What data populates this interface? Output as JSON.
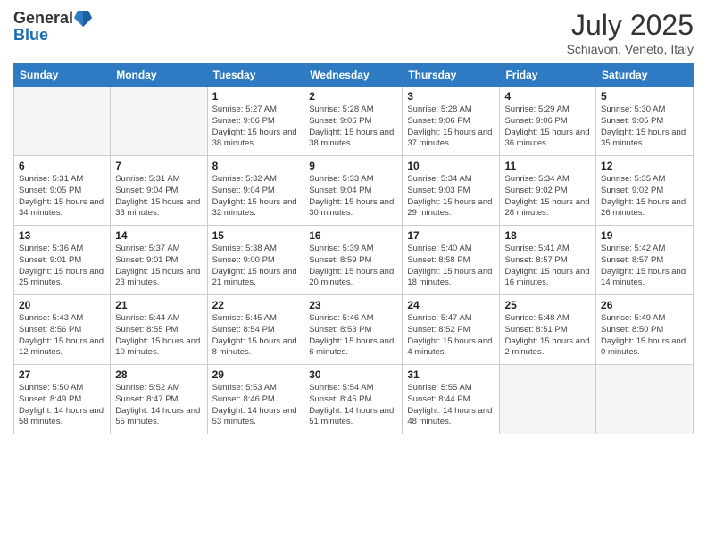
{
  "header": {
    "logo_general": "General",
    "logo_blue": "Blue",
    "month_year": "July 2025",
    "location": "Schiavon, Veneto, Italy"
  },
  "days_of_week": [
    "Sunday",
    "Monday",
    "Tuesday",
    "Wednesday",
    "Thursday",
    "Friday",
    "Saturday"
  ],
  "weeks": [
    [
      {
        "day": "",
        "info": ""
      },
      {
        "day": "",
        "info": ""
      },
      {
        "day": "1",
        "info": "Sunrise: 5:27 AM\nSunset: 9:06 PM\nDaylight: 15 hours and 38 minutes."
      },
      {
        "day": "2",
        "info": "Sunrise: 5:28 AM\nSunset: 9:06 PM\nDaylight: 15 hours and 38 minutes."
      },
      {
        "day": "3",
        "info": "Sunrise: 5:28 AM\nSunset: 9:06 PM\nDaylight: 15 hours and 37 minutes."
      },
      {
        "day": "4",
        "info": "Sunrise: 5:29 AM\nSunset: 9:06 PM\nDaylight: 15 hours and 36 minutes."
      },
      {
        "day": "5",
        "info": "Sunrise: 5:30 AM\nSunset: 9:05 PM\nDaylight: 15 hours and 35 minutes."
      }
    ],
    [
      {
        "day": "6",
        "info": "Sunrise: 5:31 AM\nSunset: 9:05 PM\nDaylight: 15 hours and 34 minutes."
      },
      {
        "day": "7",
        "info": "Sunrise: 5:31 AM\nSunset: 9:04 PM\nDaylight: 15 hours and 33 minutes."
      },
      {
        "day": "8",
        "info": "Sunrise: 5:32 AM\nSunset: 9:04 PM\nDaylight: 15 hours and 32 minutes."
      },
      {
        "day": "9",
        "info": "Sunrise: 5:33 AM\nSunset: 9:04 PM\nDaylight: 15 hours and 30 minutes."
      },
      {
        "day": "10",
        "info": "Sunrise: 5:34 AM\nSunset: 9:03 PM\nDaylight: 15 hours and 29 minutes."
      },
      {
        "day": "11",
        "info": "Sunrise: 5:34 AM\nSunset: 9:02 PM\nDaylight: 15 hours and 28 minutes."
      },
      {
        "day": "12",
        "info": "Sunrise: 5:35 AM\nSunset: 9:02 PM\nDaylight: 15 hours and 26 minutes."
      }
    ],
    [
      {
        "day": "13",
        "info": "Sunrise: 5:36 AM\nSunset: 9:01 PM\nDaylight: 15 hours and 25 minutes."
      },
      {
        "day": "14",
        "info": "Sunrise: 5:37 AM\nSunset: 9:01 PM\nDaylight: 15 hours and 23 minutes."
      },
      {
        "day": "15",
        "info": "Sunrise: 5:38 AM\nSunset: 9:00 PM\nDaylight: 15 hours and 21 minutes."
      },
      {
        "day": "16",
        "info": "Sunrise: 5:39 AM\nSunset: 8:59 PM\nDaylight: 15 hours and 20 minutes."
      },
      {
        "day": "17",
        "info": "Sunrise: 5:40 AM\nSunset: 8:58 PM\nDaylight: 15 hours and 18 minutes."
      },
      {
        "day": "18",
        "info": "Sunrise: 5:41 AM\nSunset: 8:57 PM\nDaylight: 15 hours and 16 minutes."
      },
      {
        "day": "19",
        "info": "Sunrise: 5:42 AM\nSunset: 8:57 PM\nDaylight: 15 hours and 14 minutes."
      }
    ],
    [
      {
        "day": "20",
        "info": "Sunrise: 5:43 AM\nSunset: 8:56 PM\nDaylight: 15 hours and 12 minutes."
      },
      {
        "day": "21",
        "info": "Sunrise: 5:44 AM\nSunset: 8:55 PM\nDaylight: 15 hours and 10 minutes."
      },
      {
        "day": "22",
        "info": "Sunrise: 5:45 AM\nSunset: 8:54 PM\nDaylight: 15 hours and 8 minutes."
      },
      {
        "day": "23",
        "info": "Sunrise: 5:46 AM\nSunset: 8:53 PM\nDaylight: 15 hours and 6 minutes."
      },
      {
        "day": "24",
        "info": "Sunrise: 5:47 AM\nSunset: 8:52 PM\nDaylight: 15 hours and 4 minutes."
      },
      {
        "day": "25",
        "info": "Sunrise: 5:48 AM\nSunset: 8:51 PM\nDaylight: 15 hours and 2 minutes."
      },
      {
        "day": "26",
        "info": "Sunrise: 5:49 AM\nSunset: 8:50 PM\nDaylight: 15 hours and 0 minutes."
      }
    ],
    [
      {
        "day": "27",
        "info": "Sunrise: 5:50 AM\nSunset: 8:49 PM\nDaylight: 14 hours and 58 minutes."
      },
      {
        "day": "28",
        "info": "Sunrise: 5:52 AM\nSunset: 8:47 PM\nDaylight: 14 hours and 55 minutes."
      },
      {
        "day": "29",
        "info": "Sunrise: 5:53 AM\nSunset: 8:46 PM\nDaylight: 14 hours and 53 minutes."
      },
      {
        "day": "30",
        "info": "Sunrise: 5:54 AM\nSunset: 8:45 PM\nDaylight: 14 hours and 51 minutes."
      },
      {
        "day": "31",
        "info": "Sunrise: 5:55 AM\nSunset: 8:44 PM\nDaylight: 14 hours and 48 minutes."
      },
      {
        "day": "",
        "info": ""
      },
      {
        "day": "",
        "info": ""
      }
    ]
  ]
}
